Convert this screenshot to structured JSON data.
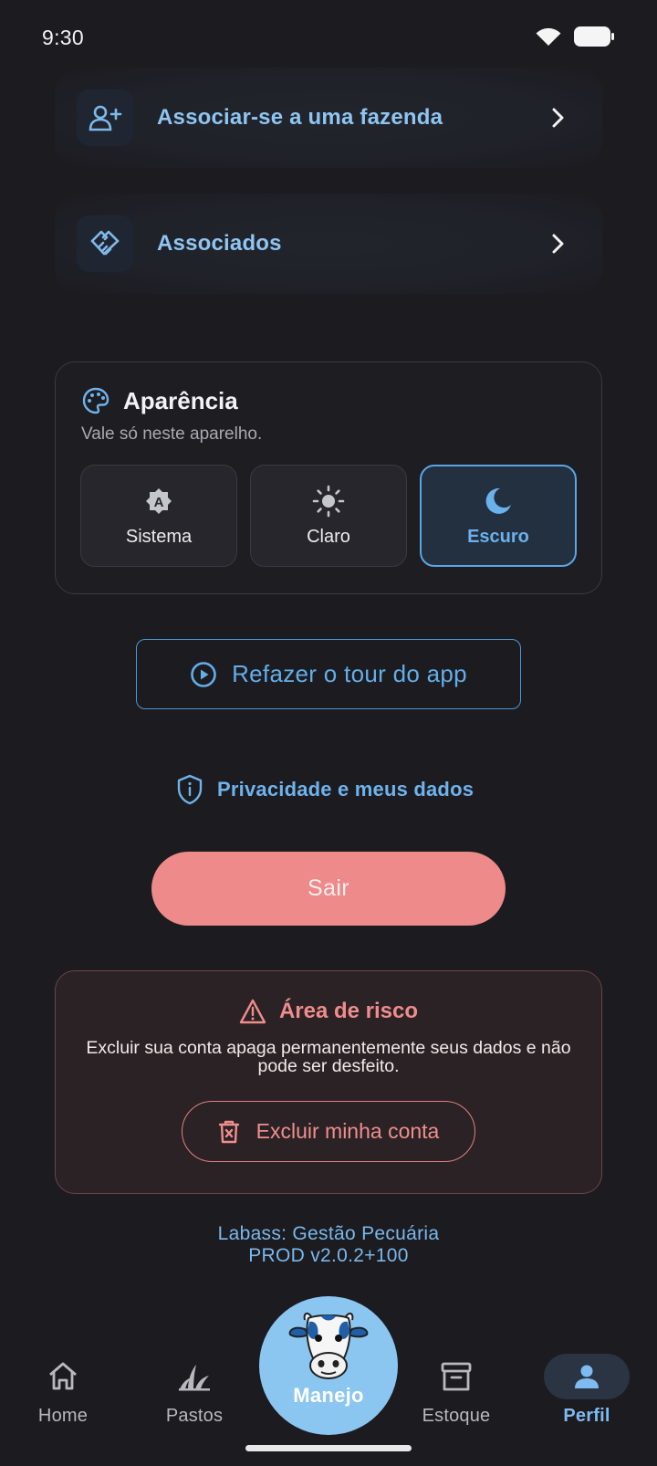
{
  "status_bar": {
    "time": "9:30"
  },
  "menu": {
    "associate_farm": {
      "label": "Associar-se a uma fazenda",
      "icon": "person-add-icon"
    },
    "associates": {
      "label": "Associados",
      "icon": "handshake-icon"
    }
  },
  "appearance": {
    "title": "Aparência",
    "subtitle": "Vale só neste aparelho.",
    "options": [
      {
        "label": "Sistema",
        "icon": "auto-mode-icon"
      },
      {
        "label": "Claro",
        "icon": "sun-icon"
      },
      {
        "label": "Escuro",
        "icon": "moon-icon"
      }
    ],
    "selected": "Escuro"
  },
  "tour_button": {
    "label": "Refazer o tour do app"
  },
  "privacy_link": {
    "label": "Privacidade e meus dados"
  },
  "logout_button": {
    "label": "Sair"
  },
  "danger_zone": {
    "title": "Área de risco",
    "description": "Excluir sua conta apaga permanentemente seus dados e não pode ser desfeito.",
    "delete_button": "Excluir minha conta"
  },
  "app_info": {
    "name": "Labass: Gestão Pecuária",
    "version": "PROD v2.0.2+100"
  },
  "bottom_nav": {
    "items": [
      {
        "label": "Home",
        "icon": "home-icon"
      },
      {
        "label": "Pastos",
        "icon": "grass-icon"
      },
      {
        "label": "Manejo",
        "icon": "cow-icon"
      },
      {
        "label": "Estoque",
        "icon": "archive-icon"
      },
      {
        "label": "Perfil",
        "icon": "person-icon"
      }
    ],
    "active": "Perfil"
  },
  "colors": {
    "background": "#1c1b20",
    "accent_blue": "#6bb1ec",
    "danger_red": "#ee8a8a",
    "fab_blue": "#8bc6f1"
  }
}
